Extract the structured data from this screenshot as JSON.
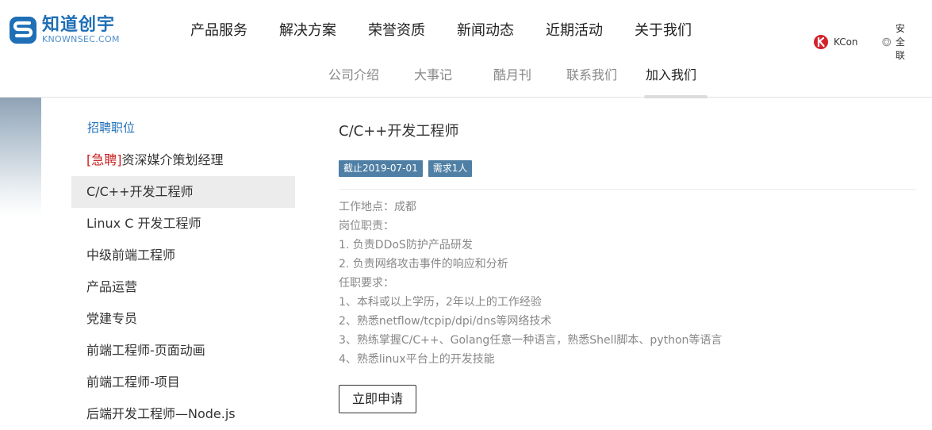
{
  "brand": {
    "name": "知道创宇",
    "name_en": "KNOWNSEC.COM"
  },
  "mainnav": [
    "产品服务",
    "解决方案",
    "荣誉资质",
    "新闻动态",
    "近期活动",
    "关于我们"
  ],
  "rightlinks": [
    {
      "label": "KCon",
      "icon": "kcon-logo-icon"
    },
    {
      "label": "安全联",
      "icon": "shield-badge-icon"
    }
  ],
  "subnav": {
    "items": [
      "公司介绍",
      "大事记",
      "酷月刊",
      "联系我们",
      "加入我们"
    ],
    "active": "加入我们"
  },
  "sidebar": {
    "title": "招聘职位",
    "urgent_prefix": "[急聘]",
    "urgent_job": "资深媒介策划经理",
    "jobs": [
      "C/C++开发工程师",
      "Linux C 开发工程师",
      "中级前端工程师",
      "产品运营",
      "党建专员",
      "前端工程师-页面动画",
      "前端工程师-项目",
      "后端开发工程师—Node.js"
    ],
    "active": "C/C++开发工程师"
  },
  "job": {
    "title": "C/C++开发工程师",
    "deadline_tag": "截止2019-07-01",
    "headcount_tag": "需求1人",
    "description": [
      "工作地点：成都",
      "岗位职责：",
      "1. 负责DDoS防护产品研发",
      "2. 负责网络攻击事件的响应和分析",
      "任职要求：",
      "1、本科或以上学历，2年以上的工作经验",
      "2、熟悉netflow/tcpip/dpi/dns等网络技术",
      "3、熟练掌握C/C++、Golang任意一种语言，熟悉Shell脚本、python等语言",
      "4、熟悉linux平台上的开发技能"
    ],
    "apply_label": "立即申请"
  },
  "colors": {
    "brand_blue": "#1f6fb6",
    "tag_bg": "#4f7fa4",
    "urgent_red": "#c81e1e",
    "active_bg": "#ececec"
  }
}
